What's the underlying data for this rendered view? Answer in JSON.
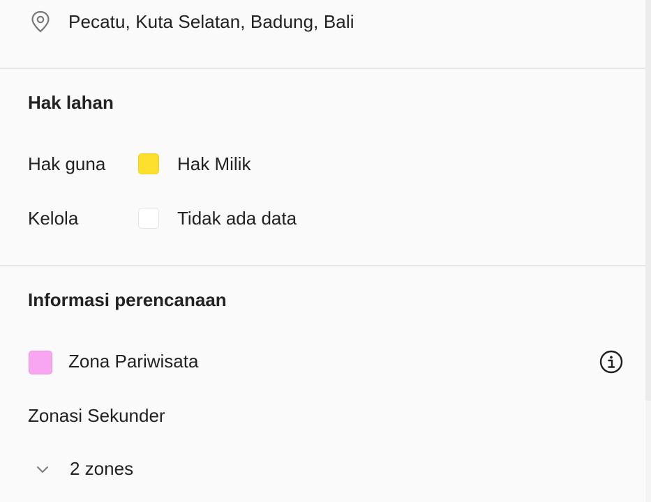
{
  "location": {
    "address": "Pecatu, Kuta Selatan, Badung, Bali",
    "icon": "location-pin-icon"
  },
  "land_rights": {
    "title": "Hak lahan",
    "rows": [
      {
        "label": "Hak guna",
        "value": "Hak Milik",
        "swatch_color": "#fde02e"
      },
      {
        "label": "Kelola",
        "value": "Tidak ada data",
        "swatch_color": "#ffffff"
      }
    ]
  },
  "planning": {
    "title": "Informasi perencanaan",
    "zone": {
      "label": "Zona Pariwisata",
      "swatch_color": "#f9a6f2",
      "info_icon": "info-icon"
    },
    "secondary_title": "Zonasi Sekunder",
    "secondary_toggle": {
      "label": "2 zones",
      "icon": "chevron-down-icon"
    }
  }
}
